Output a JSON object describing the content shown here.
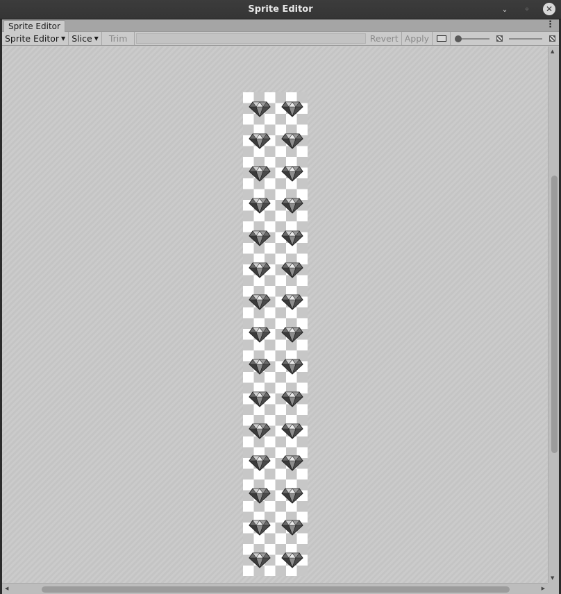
{
  "window": {
    "title": "Sprite Editor",
    "controls": {
      "minimize": "⌄",
      "restore": "◦",
      "close": "✕"
    }
  },
  "tab": {
    "label": "Sprite Editor",
    "menu_icon": "⋮"
  },
  "toolbar": {
    "mode_label": "Sprite Editor",
    "slice_label": "Slice",
    "trim_label": "Trim",
    "revert_label": "Revert",
    "apply_label": "Apply",
    "caret": "▼"
  },
  "sprite_sheet": {
    "rows": 15,
    "columns": 2,
    "sprite_icon": "diamond-gem-icon"
  },
  "scrollbars": {
    "arrow_up": "▲",
    "arrow_down": "▼",
    "arrow_left": "◀",
    "arrow_right": "▶"
  },
  "colors": {
    "titlebar": "#3a3a3a",
    "panel": "#cbcbcb",
    "checker_dark": "#c7c7c7",
    "checker_light": "#ffffff"
  }
}
